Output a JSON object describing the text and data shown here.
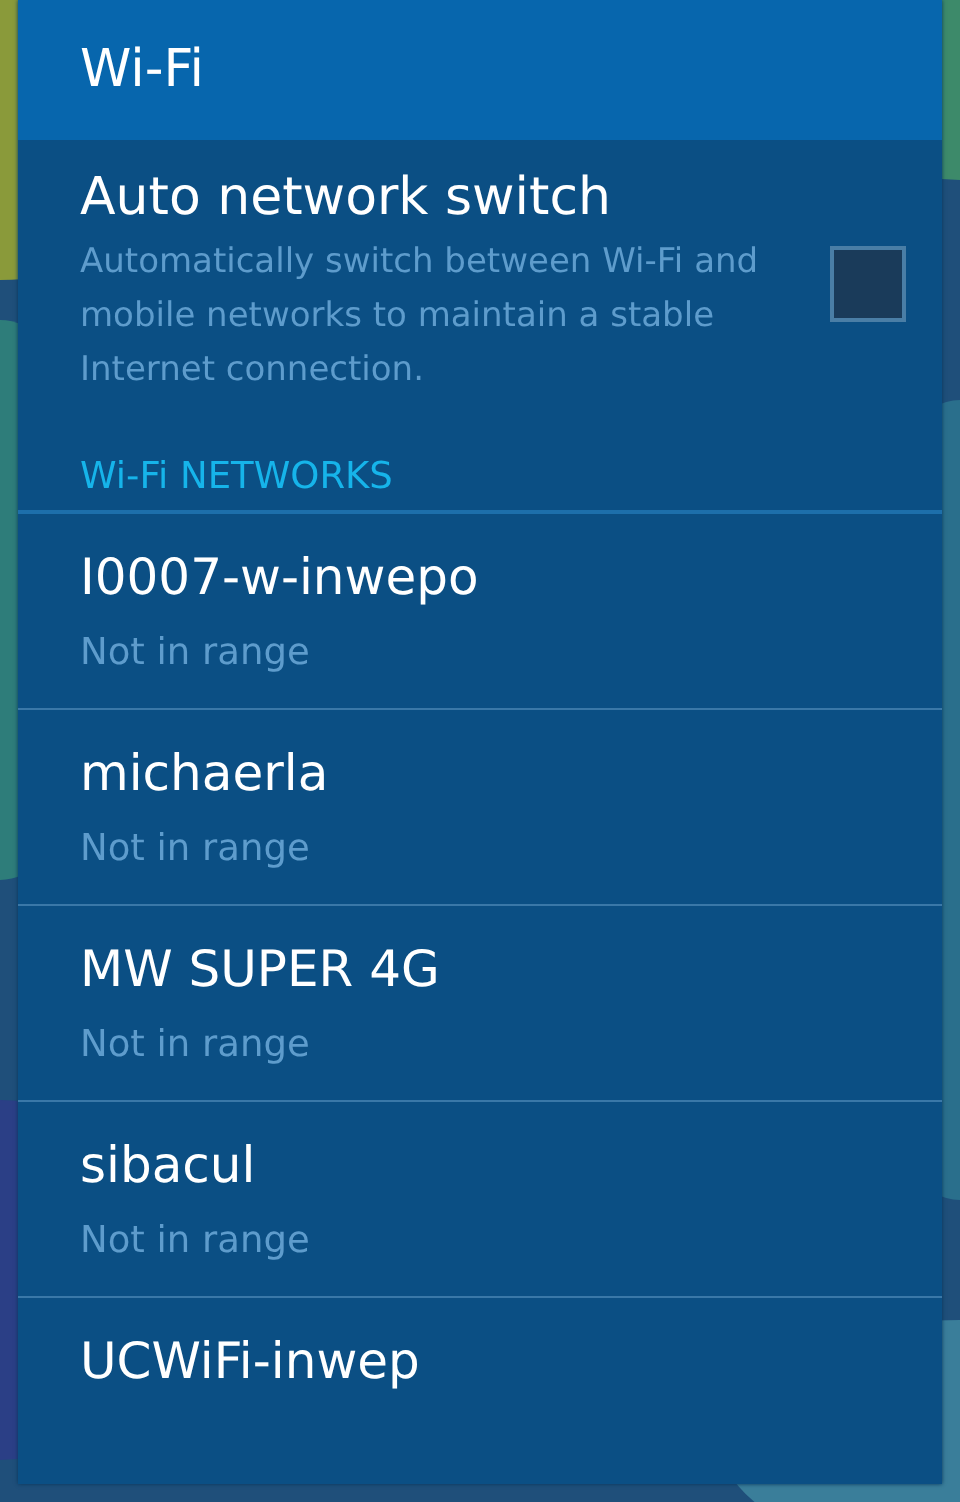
{
  "dialog": {
    "title": "Wi-Fi"
  },
  "auto_switch": {
    "title": "Auto network switch",
    "description": "Automatically switch between Wi-Fi and mobile networks to maintain a stable Internet connection.",
    "checked": false
  },
  "section": {
    "title": "Wi-Fi NETWORKS"
  },
  "networks": [
    {
      "name": "I0007-w-inwepo",
      "status": "Not in range"
    },
    {
      "name": "michaerla",
      "status": "Not in range"
    },
    {
      "name": "MW SUPER 4G",
      "status": "Not in range"
    },
    {
      "name": "sibacul",
      "status": "Not in range"
    },
    {
      "name": "UCWiFi-inwep"
    }
  ]
}
